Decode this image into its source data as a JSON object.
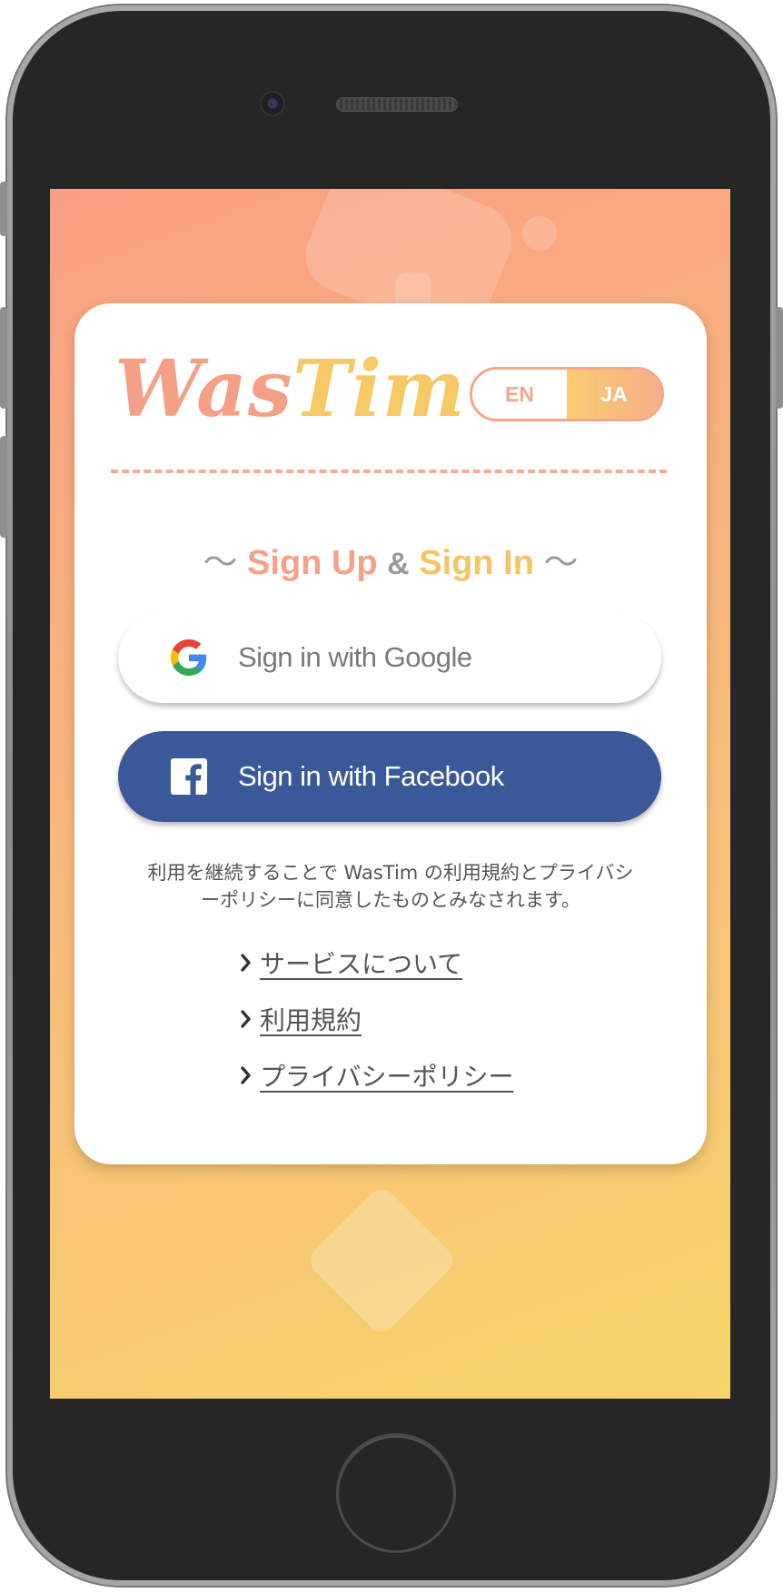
{
  "app": {
    "logo_part1": "Was",
    "logo_part2": "Tim",
    "colors": {
      "accent_peach": "#f6a18a",
      "accent_yellow": "#f6c366",
      "facebook_blue": "#3b5998",
      "text_gray": "#555555"
    }
  },
  "language_toggle": {
    "options": [
      {
        "code": "en",
        "label": "EN",
        "selected": false
      },
      {
        "code": "ja",
        "label": "JA",
        "selected": true
      }
    ]
  },
  "heading": {
    "tilde_left": "～",
    "sign_up": "Sign Up",
    "ampersand": "&",
    "sign_in": "Sign In",
    "tilde_right": "～"
  },
  "auth_buttons": {
    "google": {
      "label": "Sign in with Google",
      "icon": "google-logo-icon"
    },
    "facebook": {
      "label": "Sign in with Facebook",
      "icon": "facebook-logo-icon"
    }
  },
  "notice": {
    "line1": "利用を継続することで WasTim の利用規約とプライバシ",
    "line2": "ーポリシーに同意したものとみなされます。"
  },
  "links": [
    {
      "label": "サービスについて",
      "icon": "chevron-right-icon"
    },
    {
      "label": "利用規約",
      "icon": "chevron-right-icon"
    },
    {
      "label": "プライバシーポリシー",
      "icon": "chevron-right-icon"
    }
  ]
}
